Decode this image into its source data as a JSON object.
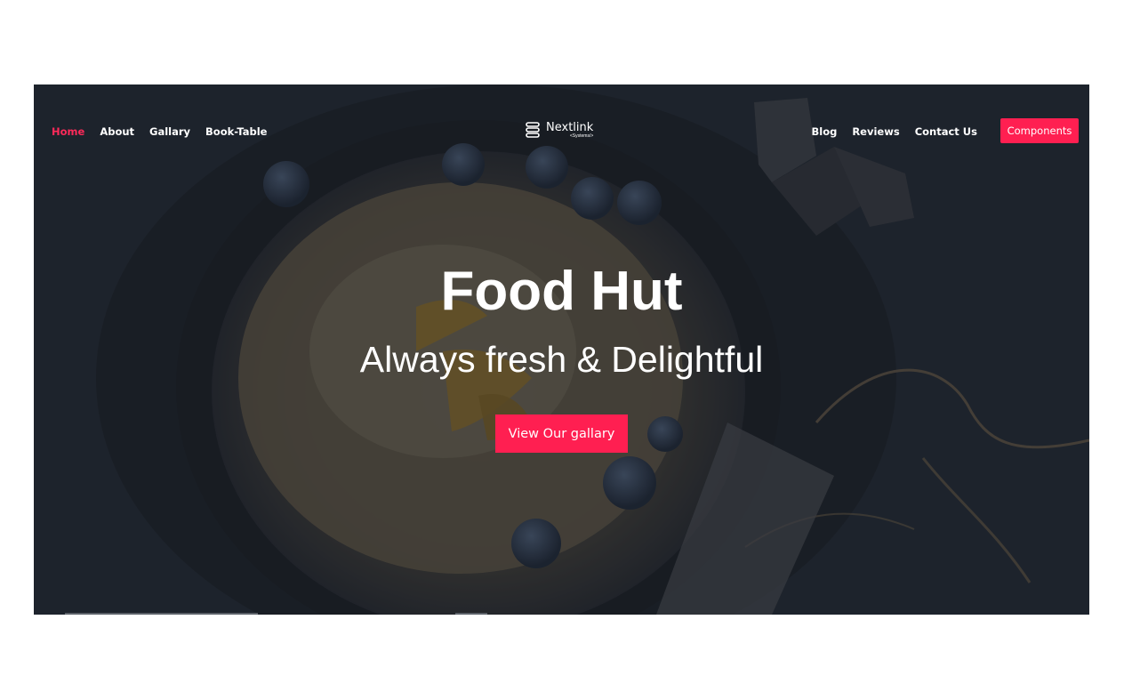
{
  "nav": {
    "left_items": [
      "Home",
      "About",
      "Gallary",
      "Book-Table"
    ],
    "right_items": [
      "Blog",
      "Reviews",
      "Contact Us"
    ],
    "active": "Home",
    "cta_label": "Components"
  },
  "logo": {
    "name": "Nextlink",
    "subtitle": "<Systems/>"
  },
  "hero": {
    "title": "Food Hut",
    "subtitle": "Always fresh & Delightful",
    "button_label": "View Our gallary",
    "background": "food-pancake-skillet-image"
  },
  "colors": {
    "accent": "#ff1f51",
    "overlay": "#1f252d",
    "text": "#ffffff"
  }
}
